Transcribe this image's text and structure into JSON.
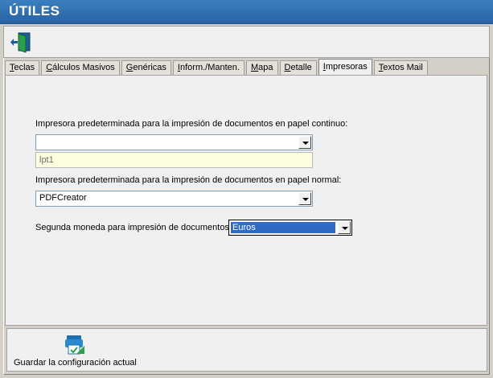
{
  "window": {
    "title": "ÚTILES"
  },
  "toolbar": {
    "exit_icon": "exit-door-icon"
  },
  "tabs": [
    {
      "label_u": "T",
      "label_rest": "eclas",
      "active": false
    },
    {
      "label_u": "C",
      "label_rest": "álculos Masivos",
      "active": false
    },
    {
      "label_u": "G",
      "label_rest": "enéricas",
      "active": false
    },
    {
      "label_u": "I",
      "label_rest": "nform./Manten.",
      "active": false
    },
    {
      "label_u": "M",
      "label_rest": "apa",
      "active": false
    },
    {
      "label_u": "D",
      "label_rest": "etalle",
      "active": false
    },
    {
      "label_u": "I",
      "label_rest": "mpresoras",
      "active": true
    },
    {
      "label_u": "T",
      "label_rest": "extos Mail",
      "active": false
    }
  ],
  "panel": {
    "continuous_label": "Impresora predeterminada para la impresión de documentos en papel continuo:",
    "continuous_value": "",
    "continuous_port": "lpt1",
    "normal_label": "Impresora predeterminada para la impresión de documentos en papel normal:",
    "normal_value": "PDFCreator",
    "currency_label": "Segunda moneda para impresión de documentos",
    "currency_value": "Euros"
  },
  "bottom": {
    "save_label": "Guardar la configuración actual",
    "save_icon": "printer-save-icon"
  },
  "colors": {
    "titlebar": "#2f6fb0",
    "selection": "#316ac5",
    "readonly_bg": "#fffde0"
  }
}
